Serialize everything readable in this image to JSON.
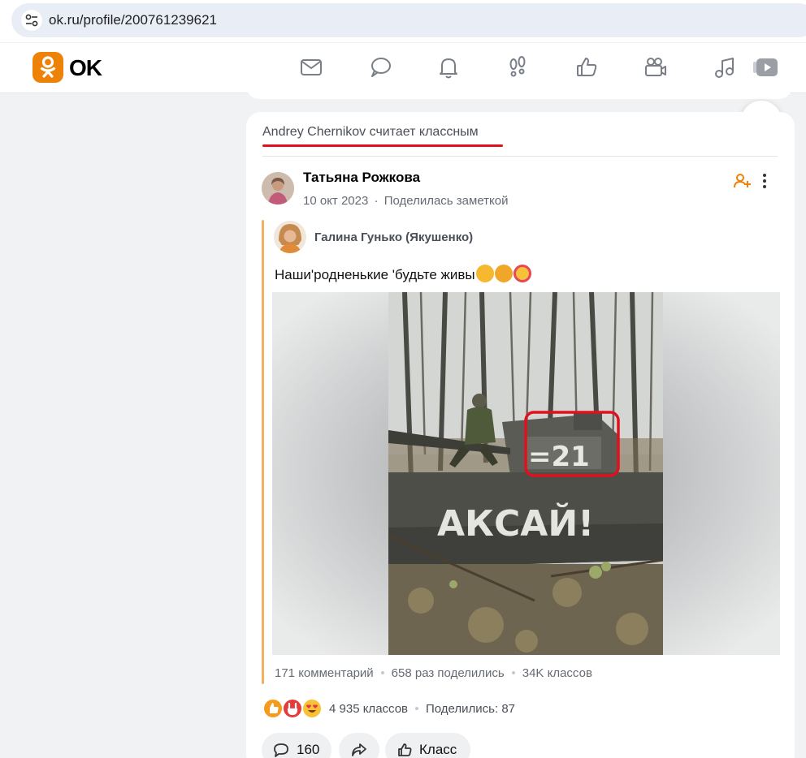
{
  "browser": {
    "url": "ok.ru/profile/200761239621",
    "site_icon": "tune-icon"
  },
  "header": {
    "logo_text": "OK",
    "nav_icons": [
      "mail-icon",
      "chat-bubble-icon",
      "bell-icon",
      "footprints-icon",
      "thumbs-up-icon",
      "video-camera-icon",
      "music-note-icon",
      "video-play-icon"
    ]
  },
  "feed": {
    "liked_by": "Andrey Chernikov",
    "liked_action": "считает классным",
    "post": {
      "author": "Татьяна Рожкова",
      "date": "10 окт 2023",
      "action": "Поделилась заметкой",
      "original_author": "Галина Гунько (Якушенко)",
      "text": "Наши'родненькие 'будьте живы",
      "text_emojis": [
        "folded-hands-emoji",
        "thumbs-up-emoji",
        "smiling-face-with-hearts-emoji"
      ],
      "photo": {
        "description_marks": [
          "tank",
          "soldier",
          "forest"
        ],
        "painted_number": "=21",
        "painted_word": "АКСАЙ!",
        "highlight_color": "#e0101e"
      },
      "stats": {
        "comments": "171 комментарий",
        "shares": "658 раз поделились",
        "likes": "34K классов"
      }
    },
    "reactions": {
      "icons": [
        "like-reaction-icon",
        "rock-hand-reaction-icon",
        "heart-eyes-reaction-icon"
      ],
      "count": "4 935 классов",
      "shared": "Поделились: 87"
    },
    "buttons": {
      "comments_count": "160",
      "share_icon": "share-arrow-icon",
      "like_label": "Класс"
    }
  },
  "colors": {
    "accent_orange": "#ee8208",
    "highlight_red": "#e0101e",
    "repost_bar": "#f2b05e"
  }
}
